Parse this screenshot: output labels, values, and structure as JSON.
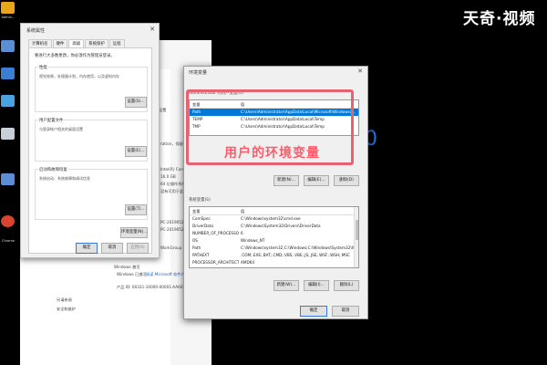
{
  "watermark": "天奇·视频",
  "desktop": {
    "icons": [
      {
        "label": "Admin…",
        "color": "#e8a61a"
      },
      {
        "label": "",
        "color": "#5a8fd6"
      },
      {
        "label": "",
        "color": "#3a7fd1"
      },
      {
        "label": "",
        "color": "#4aa3e0"
      },
      {
        "label": "",
        "color": "#c7cfd8"
      },
      {
        "label": "",
        "color": "#5b8ed6"
      },
      {
        "label": "Chrome",
        "color": "#d9442f"
      }
    ]
  },
  "system_window": {
    "lines": [
      {
        "text": "ration，保留所",
        "cls": ""
      },
      {
        "text": "Intel(R) Core",
        "cls": ""
      },
      {
        "text": "16.0 GB",
        "cls": ""
      },
      {
        "text": "64 位操作系统",
        "cls": ""
      },
      {
        "text": "没有可用于此显示",
        "cls": ""
      },
      {
        "text": "PC-20190529",
        "cls": ""
      },
      {
        "text": "PC-20190529",
        "cls": ""
      },
      {
        "text": "WorkGroup",
        "cls": ""
      }
    ],
    "windows_label": "Windows 激活",
    "activated": "Windows 已激活",
    "license": "阅读 Microsoft 软件许可",
    "product_id": "产品 ID: 00331-10000-00001-AA607",
    "see_also": "另请参阅",
    "security": "安全和维护",
    "highlight_link": "设置"
  },
  "sysprops": {
    "title": "系统属性",
    "close": "✕",
    "tabs": [
      "计算机名",
      "硬件",
      "高级",
      "系统保护",
      "远程"
    ],
    "note": "要进行大多数更改，你必须作为管理员登录。",
    "groups": [
      {
        "header": "性能",
        "desc": "视觉效果，处理器计划，内存使用，以及虚拟内存",
        "button": "设置(S)..."
      },
      {
        "header": "用户配置文件",
        "desc": "与登录帐户相关的桌面设置",
        "button": "设置(E)..."
      },
      {
        "header": "启动和故障恢复",
        "desc": "系统启动、系统故障和调试信息",
        "button": "设置(T)..."
      }
    ],
    "env_button": "环境变量(N)...",
    "ok": "确定",
    "cancel": "取消",
    "apply": "应用(A)"
  },
  "env": {
    "title": "环境变量",
    "close": "✕",
    "user_section": "Administrator 的用户变量(U)",
    "col_var": "变量",
    "col_val": "值",
    "user_vars": [
      {
        "name": "Path",
        "value": "C:\\Users\\Administrator\\AppData\\Local\\Microsoft\\Windowsa...",
        "selected": true
      },
      {
        "name": "TEMP",
        "value": "C:\\Users\\Administrator\\AppData\\Local\\Temp",
        "selected": false
      },
      {
        "name": "TMP",
        "value": "C:\\Users\\Administrator\\AppData\\Local\\Temp",
        "selected": false
      }
    ],
    "user_buttons": [
      "新建(N)...",
      "编辑(E)...",
      "删除(D)"
    ],
    "sys_section": "系统变量(S)",
    "sys_vars": [
      {
        "name": "ComSpec",
        "value": "C:\\Windows\\system32\\cmd.exe"
      },
      {
        "name": "DriverData",
        "value": "C:\\Windows\\System32\\Drivers\\DriverData"
      },
      {
        "name": "NUMBER_OF_PROCESSORS",
        "value": "6"
      },
      {
        "name": "OS",
        "value": "Windows_NT"
      },
      {
        "name": "Path",
        "value": "C:\\Windows\\system32;C:\\Windows;C:\\Windows\\System32\\Wb..."
      },
      {
        "name": "PATHEXT",
        "value": ".COM;.EXE;.BAT;.CMD;.VBS;.VBE;.JS;.JSE;.WSF;.WSH;.MSC"
      },
      {
        "name": "PROCESSOR_ARCHITECT...",
        "value": "AMD64"
      }
    ],
    "sys_buttons": [
      "新建(W)...",
      "编辑(I)...",
      "删除(L)"
    ],
    "ok": "确定",
    "cancel": "取消"
  },
  "annotation": "用户的环境变量"
}
